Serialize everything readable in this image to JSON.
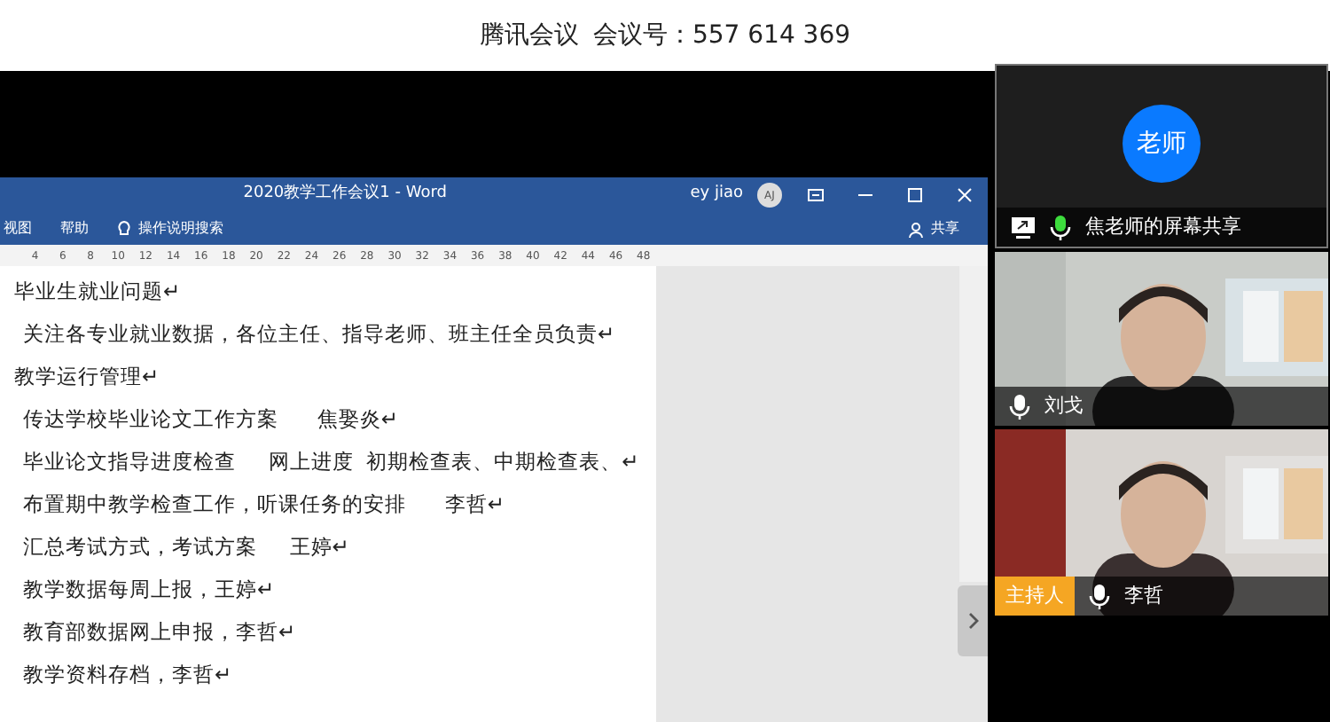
{
  "meeting_bar": {
    "app": "腾讯会议",
    "meeting_id": "会议号：557 614 369"
  },
  "word": {
    "title": "2020教学工作会议1  -  Word",
    "user": "ey jiao",
    "avatar": "AJ",
    "menu": [
      "视图",
      "帮助"
    ],
    "search_hint": "操作说明搜索",
    "share": "共享",
    "ruler": [
      "4",
      "6",
      "8",
      "10",
      "12",
      "14",
      "16",
      "18",
      "20",
      "22",
      "24",
      "26",
      "28",
      "30",
      "32",
      "34",
      "36",
      "38",
      "40",
      "42",
      "44",
      "46",
      "48"
    ],
    "paragraphs": [
      {
        "kind": "heading",
        "text": "毕业生就业问题↵"
      },
      {
        "kind": "item",
        "text": "关注各专业就业数据，各位主任、指导老师、班主任全员负责↵"
      },
      {
        "kind": "heading",
        "text": "教学运行管理↵"
      },
      {
        "kind": "item",
        "text": "传达学校毕业论文工作方案      焦娶炎↵"
      },
      {
        "kind": "item",
        "text": "毕业论文指导进度检查     网上进度  初期检查表、中期检查表、↵"
      },
      {
        "kind": "item",
        "text": "布置期中教学检查工作，听课任务的安排      李哲↵"
      },
      {
        "kind": "item",
        "text": "汇总考试方式，考试方案     王婷↵"
      },
      {
        "kind": "item",
        "text": "教学数据每周上报，王婷↵"
      },
      {
        "kind": "item",
        "text": "教育部数据网上申报，李哲↵"
      },
      {
        "kind": "item",
        "text": "教学资料存档，李哲↵"
      }
    ]
  },
  "participants": [
    {
      "kind": "avatar",
      "avatar": "老师",
      "name": "焦老师的屏幕共享",
      "sharing": true,
      "mic_active": true
    },
    {
      "kind": "video",
      "name": "刘戈",
      "mic_active": false
    },
    {
      "kind": "video",
      "name": "李哲",
      "mic_active": false,
      "host_badge": "主持人"
    }
  ]
}
